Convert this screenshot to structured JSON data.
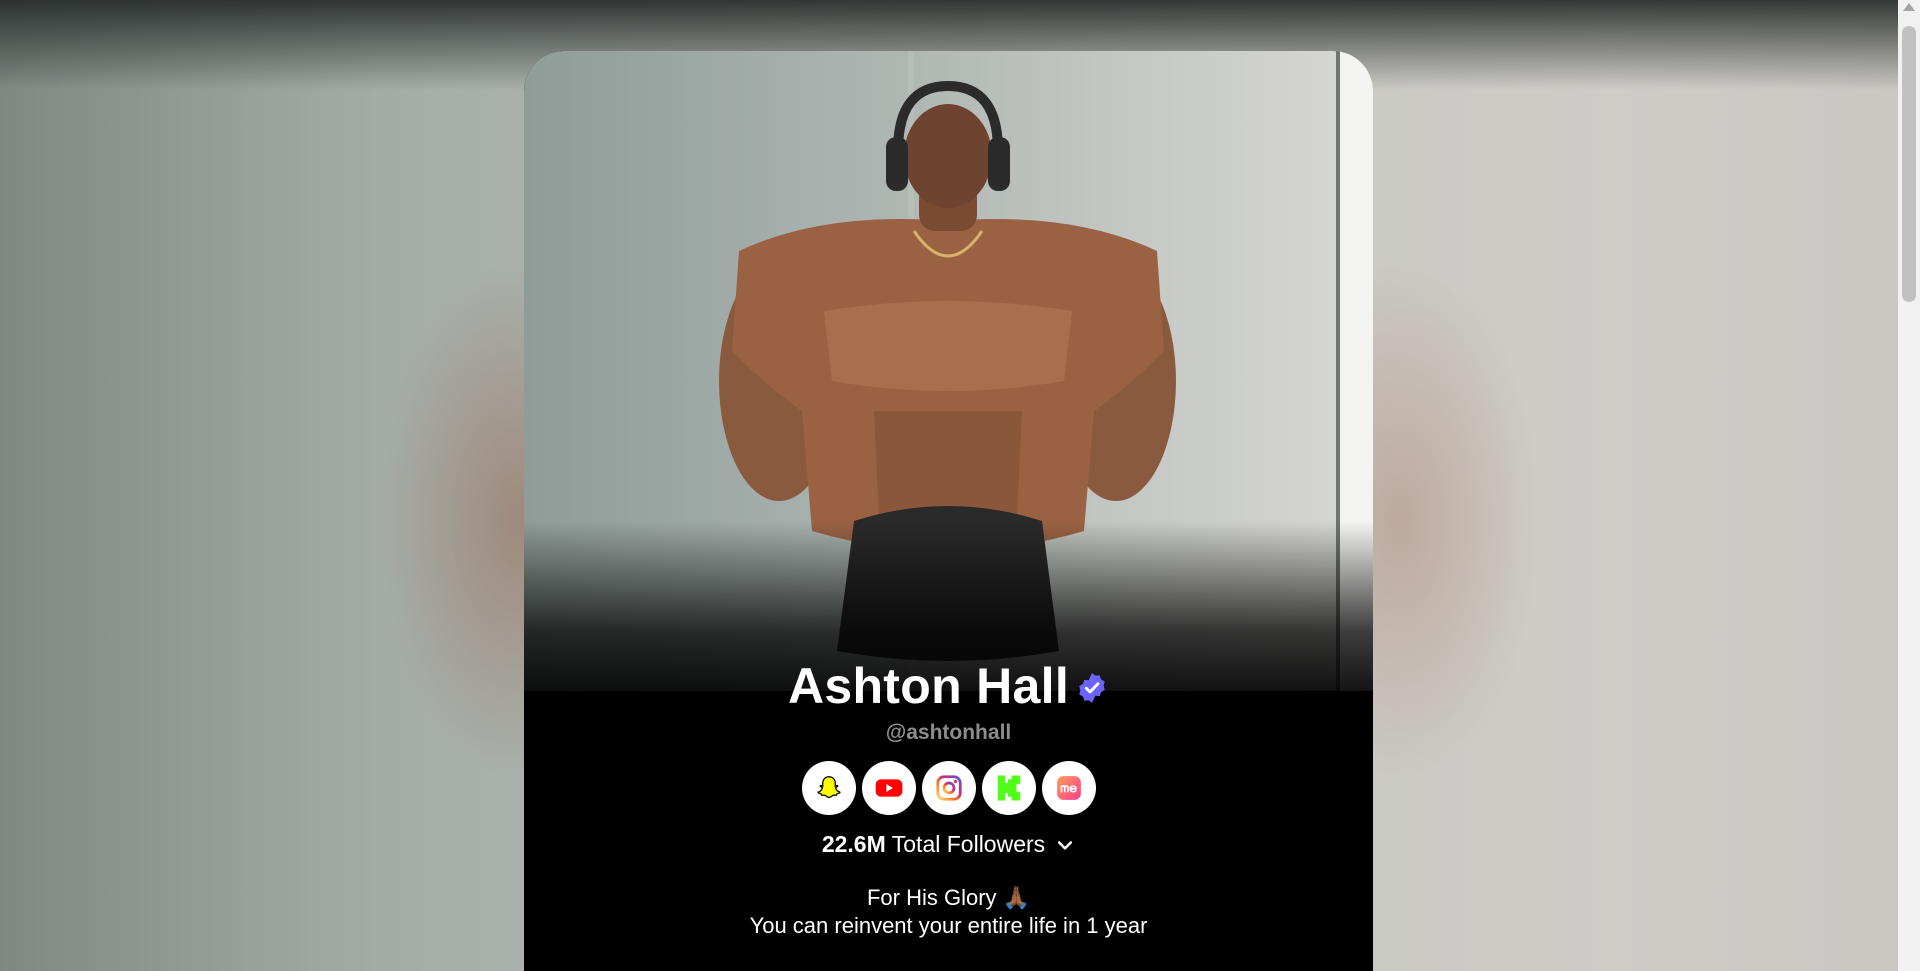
{
  "profile": {
    "name": "Ashton Hall",
    "handle": "@ashtonhall",
    "verified_badge_icon": "verified-badge-icon",
    "verified_color": "#6c63ff",
    "followers_count": "22.6M",
    "followers_label": "Total Followers",
    "bio_line_1": "For His Glory 🙏🏾",
    "bio_line_2": "You can reinvent your entire life in 1 year"
  },
  "socials": [
    {
      "name": "snapchat-icon",
      "color": "#fffc00"
    },
    {
      "name": "youtube-icon",
      "color": "#ff0000"
    },
    {
      "name": "instagram-icon",
      "color": "#d62976"
    },
    {
      "name": "kick-icon",
      "color": "#53fc18"
    },
    {
      "name": "linkme-icon",
      "color": "#ff5a7a"
    }
  ],
  "colors": {
    "card_background": "#000000",
    "handle_text": "#8d8d8d"
  }
}
